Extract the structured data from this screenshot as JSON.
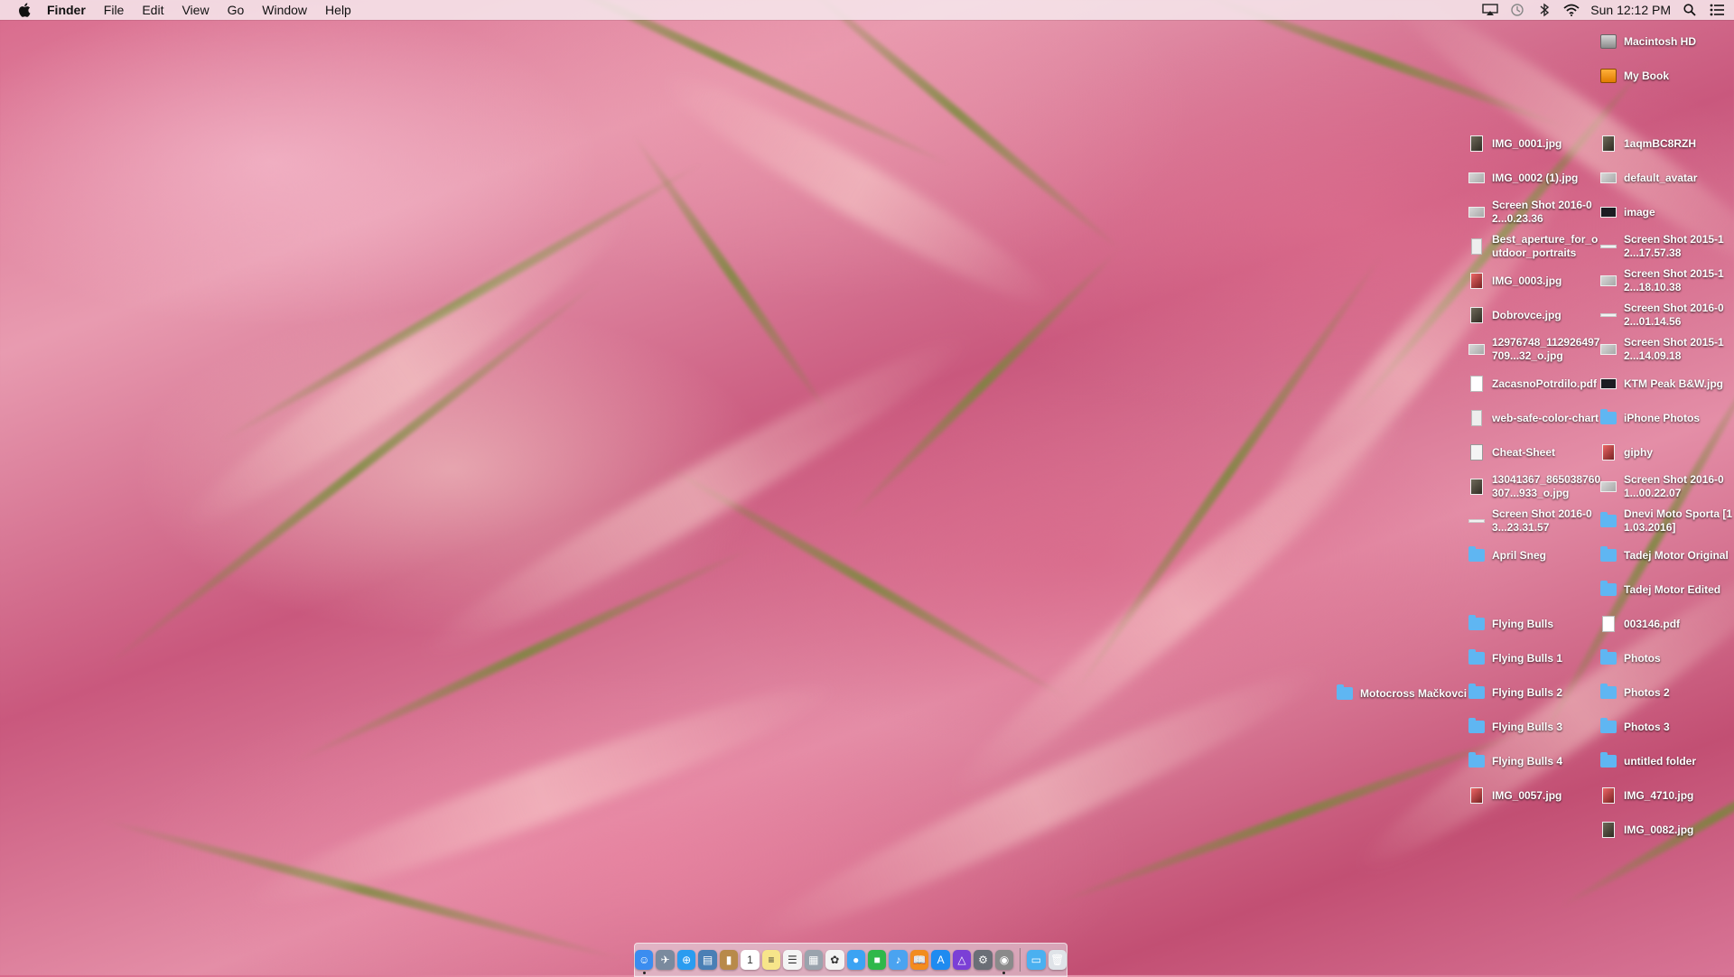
{
  "menubar": {
    "app_name": "Finder",
    "menus": [
      "File",
      "Edit",
      "View",
      "Go",
      "Window",
      "Help"
    ],
    "clock": "Sun 12:12 PM",
    "status_icons": [
      "airplay-icon",
      "time-machine-icon",
      "bluetooth-icon",
      "wifi-icon",
      "spotlight-icon",
      "notification-center-icon"
    ]
  },
  "desktop": {
    "drives": [
      {
        "label": "Macintosh HD",
        "icon": "hard-disk-icon"
      },
      {
        "label": "My Book",
        "icon": "external-disk-icon"
      }
    ],
    "column_left": [
      {
        "label": "IMG_0001.jpg",
        "icon": "image-file-icon"
      },
      {
        "label": "IMG_0002 (1).jpg",
        "icon": "image-file-icon"
      },
      {
        "label": "Screen Shot 2016-02...0.23.36",
        "icon": "screenshot-file-icon"
      },
      {
        "label": "Best_aperture_for_outdoor_portraits",
        "icon": "image-file-icon"
      },
      {
        "label": "IMG_0003.jpg",
        "icon": "image-file-icon"
      },
      {
        "label": "Dobrovce.jpg",
        "icon": "image-file-icon"
      },
      {
        "label": "12976748_112926497709...32_o.jpg",
        "icon": "image-file-icon"
      },
      {
        "label": "ZacasnoPotrdilo.pdf",
        "icon": "pdf-file-icon"
      },
      {
        "label": "web-safe-color-chart",
        "icon": "image-file-icon"
      },
      {
        "label": "Cheat-Sheet",
        "icon": "document-file-icon"
      },
      {
        "label": "13041367_865038760307...933_o.jpg",
        "icon": "image-file-icon"
      },
      {
        "label": "Screen Shot 2016-03...23.31.57",
        "icon": "screenshot-file-icon"
      },
      {
        "label": "April Sneg",
        "icon": "folder-icon"
      },
      {
        "label": "",
        "icon": ""
      },
      {
        "label": "Flying Bulls",
        "icon": "folder-icon"
      },
      {
        "label": "Flying Bulls 1",
        "icon": "folder-icon"
      },
      {
        "label": "Flying Bulls 2",
        "icon": "folder-icon"
      },
      {
        "label": "Flying Bulls 3",
        "icon": "folder-icon"
      },
      {
        "label": "Flying Bulls 4",
        "icon": "folder-icon"
      },
      {
        "label": "IMG_0057.jpg",
        "icon": "image-file-icon"
      }
    ],
    "column_right": [
      {
        "label": "1aqmBC8RZH",
        "icon": "image-file-icon"
      },
      {
        "label": "default_avatar",
        "icon": "image-file-icon"
      },
      {
        "label": "image",
        "icon": "image-file-icon"
      },
      {
        "label": "Screen Shot 2015-12...17.57.38",
        "icon": "screenshot-file-icon"
      },
      {
        "label": "Screen Shot 2015-12...18.10.38",
        "icon": "screenshot-file-icon"
      },
      {
        "label": "Screen Shot 2016-02...01.14.56",
        "icon": "screenshot-file-icon"
      },
      {
        "label": "Screen Shot 2015-12...14.09.18",
        "icon": "screenshot-file-icon"
      },
      {
        "label": "KTM Peak B&W.jpg",
        "icon": "image-file-icon"
      },
      {
        "label": "iPhone Photos",
        "icon": "folder-icon"
      },
      {
        "label": "giphy",
        "icon": "image-file-icon"
      },
      {
        "label": "Screen Shot 2016-01...00.22.07",
        "icon": "screenshot-file-icon"
      },
      {
        "label": "Dnevi Moto Sporta [11.03.2016]",
        "icon": "folder-icon"
      },
      {
        "label": "Tadej Motor Original",
        "icon": "folder-icon"
      },
      {
        "label": "Tadej Motor Edited",
        "icon": "folder-icon"
      },
      {
        "label": "003146.pdf",
        "icon": "pdf-file-icon"
      },
      {
        "label": "Photos",
        "icon": "folder-icon"
      },
      {
        "label": "Photos 2",
        "icon": "folder-icon"
      },
      {
        "label": "Photos 3",
        "icon": "folder-icon"
      },
      {
        "label": "untitled folder",
        "icon": "folder-icon"
      },
      {
        "label": "IMG_4710.jpg",
        "icon": "image-file-icon"
      },
      {
        "label": "IMG_0082.jpg",
        "icon": "image-file-icon"
      }
    ],
    "loose": [
      {
        "label": "Motocross Mačkovci",
        "icon": "folder-icon"
      }
    ]
  },
  "dock": {
    "apps": [
      {
        "name": "finder-app-icon",
        "color": "#3b8df0",
        "glyph": "☺",
        "running": true
      },
      {
        "name": "launchpad-app-icon",
        "color": "#7a8a9e",
        "glyph": "✈",
        "running": false
      },
      {
        "name": "safari-app-icon",
        "color": "#2a9cf0",
        "glyph": "⊕",
        "running": false
      },
      {
        "name": "preview-app-icon",
        "color": "#4a7fb5",
        "glyph": "▤",
        "running": false
      },
      {
        "name": "notebook-app-icon",
        "color": "#b88a4a",
        "glyph": "▮",
        "running": false
      },
      {
        "name": "calendar-app-icon",
        "color": "#ffffff",
        "glyph": "1",
        "running": false
      },
      {
        "name": "notes-app-icon",
        "color": "#f7e58a",
        "glyph": "≡",
        "running": false
      },
      {
        "name": "reminders-app-icon",
        "color": "#f4f4f4",
        "glyph": "☰",
        "running": false
      },
      {
        "name": "photos-preview-app-icon",
        "color": "#9aa3ad",
        "glyph": "▦",
        "running": false
      },
      {
        "name": "photos-app-icon",
        "color": "#f3f3f3",
        "glyph": "✿",
        "running": false
      },
      {
        "name": "messages-app-icon",
        "color": "#3ba3f3",
        "glyph": "●",
        "running": false
      },
      {
        "name": "facetime-app-icon",
        "color": "#2fb84a",
        "glyph": "■",
        "running": false
      },
      {
        "name": "itunes-app-icon",
        "color": "#4aa3f0",
        "glyph": "♪",
        "running": false
      },
      {
        "name": "ibooks-app-icon",
        "color": "#f28c1e",
        "glyph": "📖",
        "running": false
      },
      {
        "name": "app-store-app-icon",
        "color": "#1f8bf0",
        "glyph": "A",
        "running": false
      },
      {
        "name": "affinity-app-icon",
        "color": "#7b3fd6",
        "glyph": "△",
        "running": false
      },
      {
        "name": "system-preferences-app-icon",
        "color": "#6a6e76",
        "glyph": "⚙",
        "running": false
      },
      {
        "name": "activity-monitor-app-icon",
        "color": "#8a8a8a",
        "glyph": "◉",
        "running": true
      }
    ],
    "stacks": [
      {
        "name": "downloads-stack-icon",
        "color": "#4ab0f0",
        "glyph": "▭"
      },
      {
        "name": "trash-icon",
        "color": "#dfe3e8",
        "glyph": "🗑"
      }
    ]
  }
}
